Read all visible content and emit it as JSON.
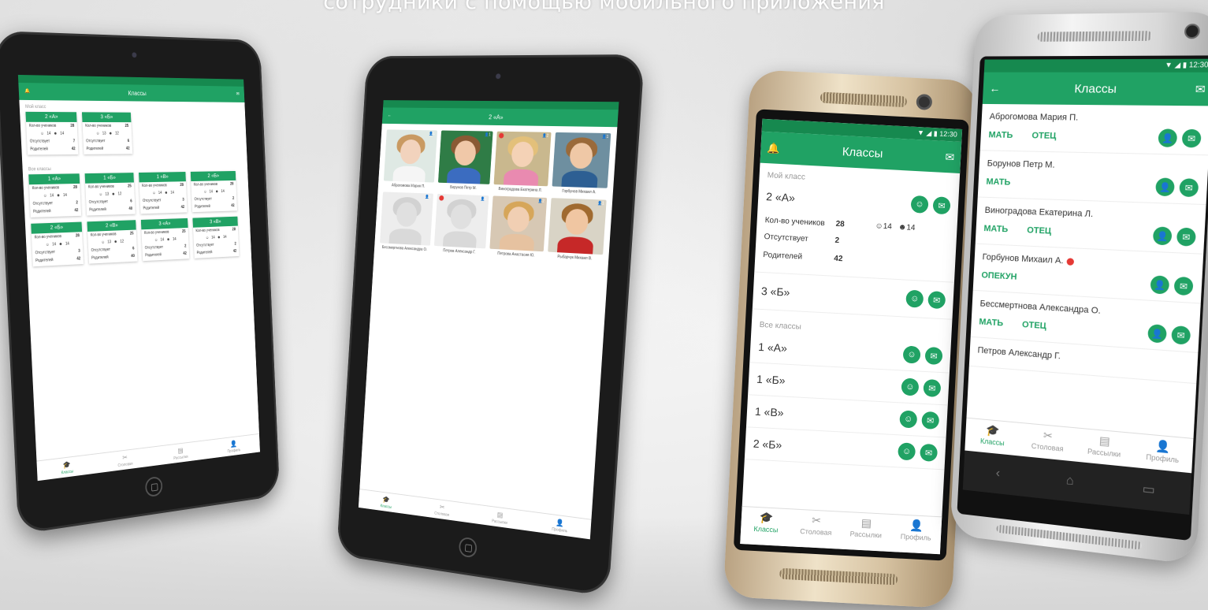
{
  "headline": "сотрудники с помощью мобильного приложения",
  "colors": {
    "accent": "#20a264",
    "status_bar": "#16894f",
    "alert": "#e53935"
  },
  "tablet_left": {
    "title": "Классы",
    "my_class_label": "Мой класс",
    "all_classes_label": "Все классы",
    "my_cards": [
      {
        "name": "2 «А»",
        "students_label": "Кол-во учеников",
        "students": "28",
        "boys": "14",
        "girls": "14",
        "absent_label": "Отсутствует",
        "absent": "7",
        "parents_label": "Родителей",
        "parents": "42"
      },
      {
        "name": "3 «Б»",
        "students_label": "Кол-во учеников",
        "students": "25",
        "boys": "13",
        "girls": "12",
        "absent_label": "Отсутствует",
        "absent": "6",
        "parents_label": "Родителей",
        "parents": "42"
      }
    ],
    "all_cards": [
      {
        "name": "1 «А»",
        "students_label": "Кол-во учеников",
        "students": "28",
        "boys": "14",
        "girls": "14",
        "absent_label": "Отсутствует",
        "absent": "2",
        "parents_label": "Родителей",
        "parents": "42"
      },
      {
        "name": "1 «Б»",
        "students_label": "Кол-во учеников",
        "students": "25",
        "boys": "13",
        "girls": "12",
        "absent_label": "Отсутствует",
        "absent": "6",
        "parents_label": "Родителей",
        "parents": "40"
      },
      {
        "name": "1 «В»",
        "students_label": "Кол-во учеников",
        "students": "28",
        "boys": "14",
        "girls": "14",
        "absent_label": "Отсутствует",
        "absent": "3",
        "parents_label": "Родителей",
        "parents": "42"
      },
      {
        "name": "2 «Б»",
        "students_label": "Кол-во учеников",
        "students": "28",
        "boys": "14",
        "girls": "14",
        "absent_label": "Отсутствует",
        "absent": "2",
        "parents_label": "Родителей",
        "parents": "42"
      },
      {
        "name": "2 «Б»",
        "students_label": "Кол-во учеников",
        "students": "28",
        "boys": "14",
        "girls": "14",
        "absent_label": "Отсутствует",
        "absent": "3",
        "parents_label": "Родителей",
        "parents": "42"
      },
      {
        "name": "2 «В»",
        "students_label": "Кол-во учеников",
        "students": "25",
        "boys": "13",
        "girls": "12",
        "absent_label": "Отсутствует",
        "absent": "6",
        "parents_label": "Родителей",
        "parents": "40"
      },
      {
        "name": "3 «А»",
        "students_label": "Кол-во учеников",
        "students": "25",
        "boys": "14",
        "girls": "14",
        "absent_label": "Отсутствует",
        "absent": "2",
        "parents_label": "Родителей",
        "parents": "42"
      },
      {
        "name": "3 «В»",
        "students_label": "Кол-во учеников",
        "students": "28",
        "boys": "14",
        "girls": "14",
        "absent_label": "Отсутствует",
        "absent": "2",
        "parents_label": "Родителей",
        "parents": "42"
      }
    ],
    "tabs": [
      {
        "label": "Классы",
        "icon": "graduation-cap-icon",
        "active": true
      },
      {
        "label": "Столовая",
        "icon": "fork-knife-icon"
      },
      {
        "label": "Рассылки",
        "icon": "newsletter-icon"
      },
      {
        "label": "Профиль",
        "icon": "profile-icon"
      }
    ]
  },
  "tablet_mid": {
    "title": "2 «А»",
    "pupils": [
      {
        "name": "Абрагомова Мария П.",
        "count": "1",
        "palette": "girl"
      },
      {
        "name": "Борунов Петр М.",
        "count": "1",
        "palette": "boy"
      },
      {
        "name": "Виноградова Екатерина Л.",
        "count": "2",
        "palette": "girl2",
        "alert": true
      },
      {
        "name": "Горбунов Михаил А.",
        "count": "1",
        "palette": "boy2"
      },
      {
        "name": "Бессмертнова Александра О.",
        "count": "1",
        "placeholder": true
      },
      {
        "name": "Петров Александр Г.",
        "count": "1",
        "placeholder": true,
        "alert": true
      },
      {
        "name": "Петрова Анастасия Ю.",
        "count": "2",
        "palette": "girl3"
      },
      {
        "name": "Рыбарчук Михаил В.",
        "count": "1",
        "palette": "boy3"
      }
    ],
    "tabs": [
      {
        "label": "Классы",
        "active": true
      },
      {
        "label": "Столовая"
      },
      {
        "label": "Рассылки"
      },
      {
        "label": "Профиль"
      }
    ]
  },
  "phone_gold": {
    "time": "12:30",
    "title": "Классы",
    "my_class_label": "Мой класс",
    "my_class": {
      "name": "2 «А»",
      "students_label": "Кол-во учеников",
      "students": "28",
      "boys": "14",
      "girls": "14",
      "absent_label": "Отсутствует",
      "absent": "2",
      "parents_label": "Родителей",
      "parents": "42"
    },
    "second_class": "3 «Б»",
    "all_classes_label": "Все классы",
    "all_classes": [
      "1 «А»",
      "1 «Б»",
      "1 «В»",
      "2 «Б»"
    ],
    "tabs": [
      {
        "label": "Классы",
        "icon": "graduation-cap-icon",
        "active": true
      },
      {
        "label": "Столовая",
        "icon": "fork-knife-icon"
      },
      {
        "label": "Рассылки",
        "icon": "newsletter-icon"
      },
      {
        "label": "Профиль",
        "icon": "profile-icon"
      }
    ]
  },
  "phone_silver": {
    "time": "12:30",
    "title": "Классы",
    "students": [
      {
        "name": "Аброгомова Мария П.",
        "relations": [
          "МАТЬ",
          "ОТЕЦ"
        ]
      },
      {
        "name": "Борунов Петр М.",
        "relations": [
          "МАТЬ"
        ]
      },
      {
        "name": "Виноградова Екатерина Л.",
        "relations": [
          "МАТЬ",
          "ОТЕЦ"
        ]
      },
      {
        "name": "Горбунов Михаил А.",
        "relations": [
          "ОПЕКУН"
        ],
        "alert": true
      },
      {
        "name": "Бессмертнова Александра О.",
        "relations": [
          "МАТЬ",
          "ОТЕЦ"
        ]
      },
      {
        "name": "Петров Александр Г.",
        "relations": []
      }
    ],
    "tabs": [
      {
        "label": "Классы",
        "icon": "graduation-cap-icon",
        "active": true
      },
      {
        "label": "Столовая",
        "icon": "fork-knife-icon"
      },
      {
        "label": "Рассылки",
        "icon": "newsletter-icon"
      },
      {
        "label": "Профиль",
        "icon": "profile-icon"
      }
    ]
  }
}
